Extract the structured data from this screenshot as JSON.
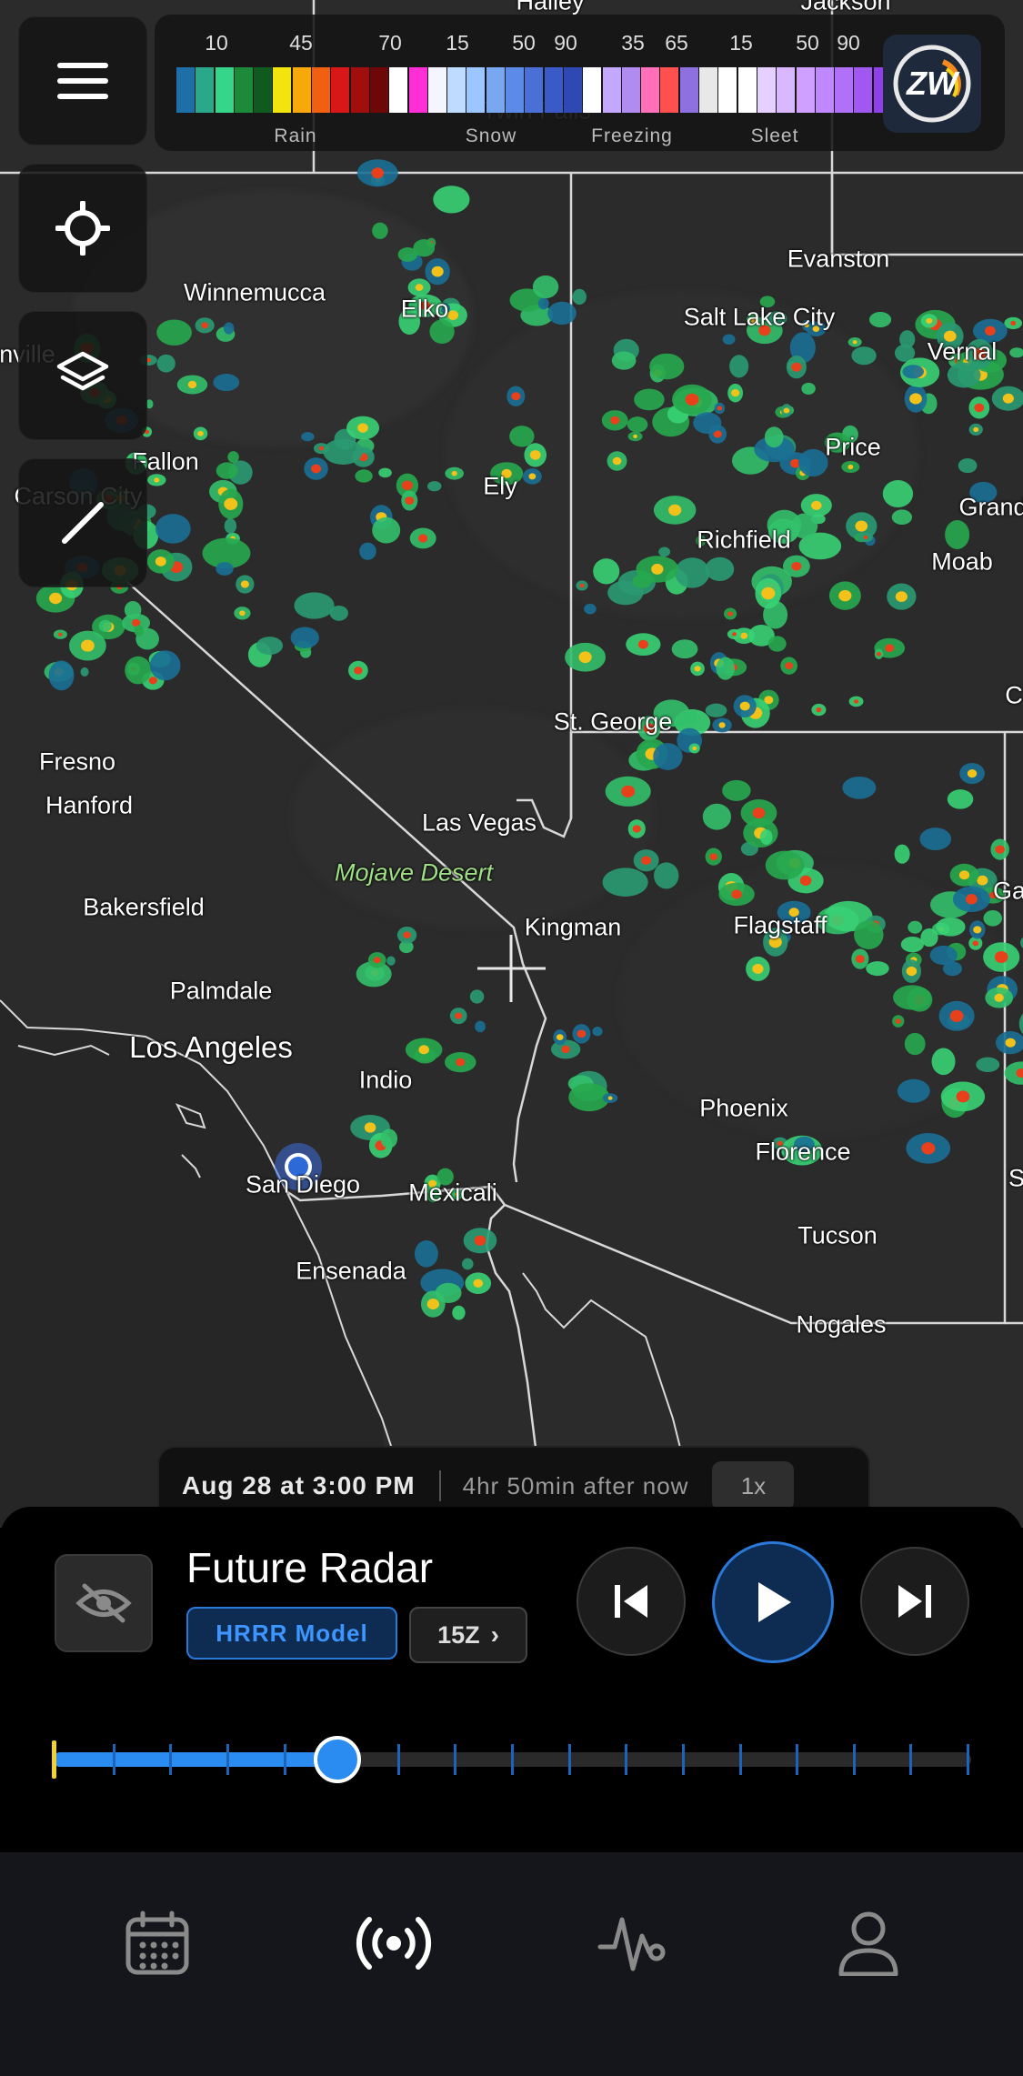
{
  "map": {
    "cities": [
      {
        "name": "Hailey",
        "id": "hailey"
      },
      {
        "name": "Jackson",
        "id": "jackson"
      },
      {
        "name": "Twin Falls",
        "id": "twin-falls"
      },
      {
        "name": "Evanston",
        "id": "evanston"
      },
      {
        "name": "Winnemucca",
        "id": "winnemucca"
      },
      {
        "name": "Elko",
        "id": "elko"
      },
      {
        "name": "Salt Lake City",
        "id": "salt-lake-city"
      },
      {
        "name": "Vernal",
        "id": "vernal"
      },
      {
        "name": "nville",
        "id": "lovelock"
      },
      {
        "name": "Fallon",
        "id": "fallon"
      },
      {
        "name": "Price",
        "id": "price"
      },
      {
        "name": "Carson City",
        "id": "carson-city"
      },
      {
        "name": "Ely",
        "id": "ely"
      },
      {
        "name": "Grand",
        "id": "grand-junction"
      },
      {
        "name": "Richfield",
        "id": "richfield"
      },
      {
        "name": "Moab",
        "id": "moab"
      },
      {
        "name": "C",
        "id": "cortez"
      },
      {
        "name": "St. George",
        "id": "st-george"
      },
      {
        "name": "Fresno",
        "id": "fresno"
      },
      {
        "name": "Hanford",
        "id": "hanford"
      },
      {
        "name": "Las Vegas",
        "id": "las-vegas"
      },
      {
        "name": "Mojave Desert",
        "id": "mojave-desert"
      },
      {
        "name": "Ga",
        "id": "gallup"
      },
      {
        "name": "Bakersfield",
        "id": "bakersfield"
      },
      {
        "name": "Kingman",
        "id": "kingman"
      },
      {
        "name": "Flagstaff",
        "id": "flagstaff"
      },
      {
        "name": "Palmdale",
        "id": "palmdale"
      },
      {
        "name": "Los Angeles",
        "id": "los-angeles"
      },
      {
        "name": "Indio",
        "id": "indio"
      },
      {
        "name": "Phoenix",
        "id": "phoenix"
      },
      {
        "name": "Florence",
        "id": "florence"
      },
      {
        "name": "S",
        "id": "silver-city"
      },
      {
        "name": "San Diego",
        "id": "san-diego"
      },
      {
        "name": "Mexicali",
        "id": "mexicali"
      },
      {
        "name": "Ensenada",
        "id": "ensenada"
      },
      {
        "name": "Tucson",
        "id": "tucson"
      },
      {
        "name": "Nogales",
        "id": "nogales"
      }
    ]
  },
  "legend": {
    "numbers": [
      "10",
      "45",
      "70",
      "15",
      "50",
      "90",
      "35",
      "65",
      "15",
      "50",
      "90"
    ],
    "categories": [
      "Rain",
      "Snow",
      "Freezing",
      "Sleet"
    ],
    "colors": [
      "#1e6fa8",
      "#2aa88a",
      "#35d58a",
      "#1d8a3a",
      "#0f5a1e",
      "#f2e40c",
      "#f7a80a",
      "#f06010",
      "#d81818",
      "#a00e0e",
      "#6e0808",
      "#ffffff",
      "#ff2fd6",
      "#f5f5ff",
      "#bfdcff",
      "#9cc6ff",
      "#7aa8f0",
      "#5c8ae8",
      "#4a70d8",
      "#3a5ac8",
      "#2f48b4",
      "#ffffff",
      "#c4a8ff",
      "#b08cf0",
      "#ff70b8",
      "#ff5050",
      "#8e70e0",
      "#e8e8e8",
      "#ffffff",
      "#ffffff",
      "#e6d0ff",
      "#dab8ff",
      "#cfa0ff",
      "#c088ff",
      "#b070f8",
      "#a058f0",
      "#9040e8"
    ],
    "logo_text": "ZW"
  },
  "sidebar": {
    "menu_icon": "menu-icon",
    "location_icon": "crosshair-icon",
    "layers_icon": "layers-icon",
    "draw_icon": "pencil-icon"
  },
  "timebar": {
    "date": "Aug 28 at 3:00 PM",
    "relative": "4hr 50min after now",
    "speed": "1x"
  },
  "panel": {
    "title": "Future Radar",
    "model": "HRRR Model",
    "run": "15Z",
    "run_chevron": "›",
    "progress": 0.31,
    "tick_count": 17
  },
  "colors": {
    "accent": "#2a8cf0",
    "panel_bg": "#000000",
    "tabbar_bg": "#15161b"
  },
  "tabs": [
    {
      "id": "calendar",
      "icon": "calendar-icon"
    },
    {
      "id": "radar",
      "icon": "radar-broadcast-icon",
      "active": true
    },
    {
      "id": "activity",
      "icon": "pulse-icon"
    },
    {
      "id": "profile",
      "icon": "profile-icon"
    }
  ]
}
